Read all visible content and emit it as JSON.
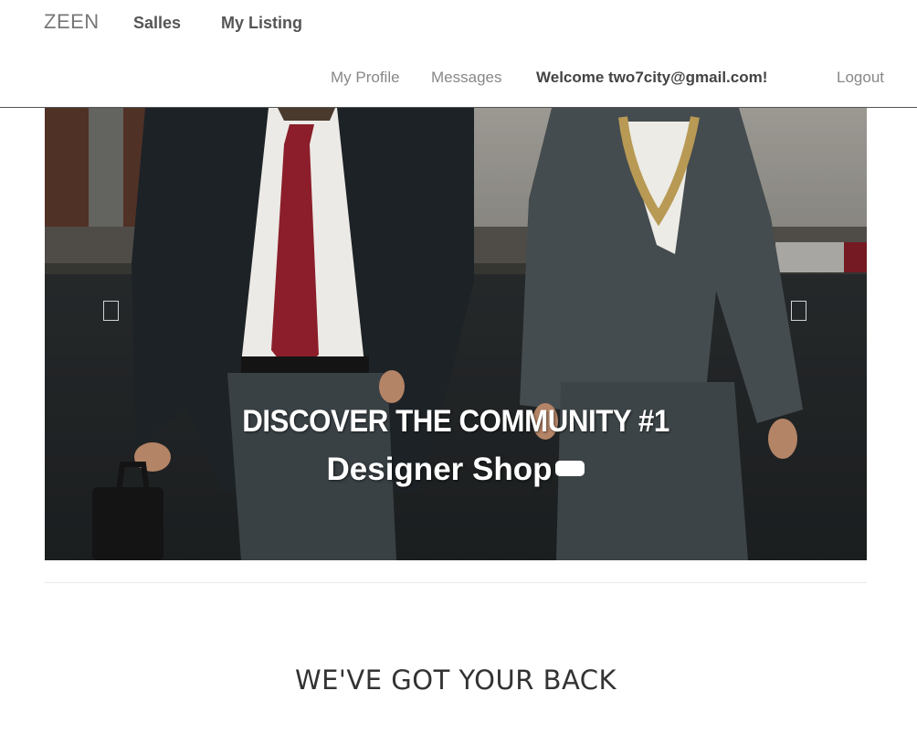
{
  "navbar": {
    "brand": "ZEEN",
    "main_links": [
      "Salles",
      "My Listing"
    ],
    "profile": "My Profile",
    "messages": "Messages",
    "welcome": "Welcome two7city@gmail.com!",
    "logout": "Logout"
  },
  "hero": {
    "line1": "DISCOVER THE COMMUNITY #1",
    "line2": "Designer Shop",
    "prev_icon": "square-outline-icon",
    "next_icon": "square-outline-icon"
  },
  "section": {
    "title": "WE'VE GOT YOUR BACK"
  },
  "colors": {
    "text_dark": "#333333",
    "nav_muted": "#888888",
    "brand_gray": "#777777",
    "tie_red": "#8b1e2a"
  }
}
